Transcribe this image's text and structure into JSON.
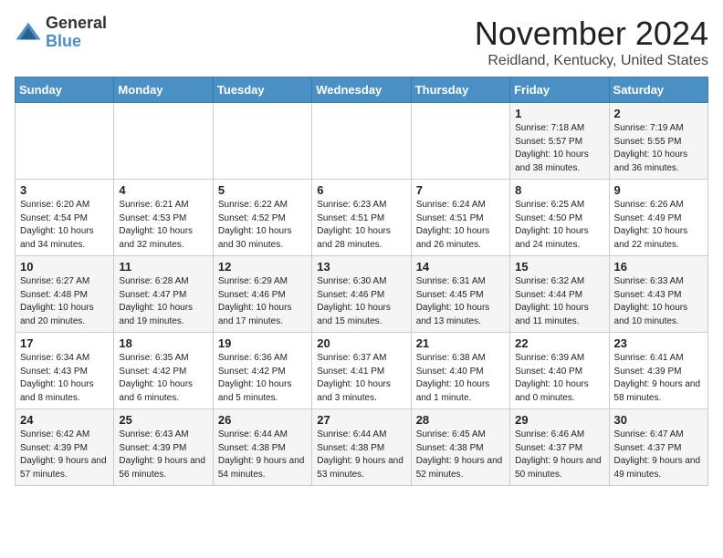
{
  "logo": {
    "general": "General",
    "blue": "Blue"
  },
  "title": "November 2024",
  "location": "Reidland, Kentucky, United States",
  "days_of_week": [
    "Sunday",
    "Monday",
    "Tuesday",
    "Wednesday",
    "Thursday",
    "Friday",
    "Saturday"
  ],
  "weeks": [
    [
      {
        "day": "",
        "info": ""
      },
      {
        "day": "",
        "info": ""
      },
      {
        "day": "",
        "info": ""
      },
      {
        "day": "",
        "info": ""
      },
      {
        "day": "",
        "info": ""
      },
      {
        "day": "1",
        "info": "Sunrise: 7:18 AM\nSunset: 5:57 PM\nDaylight: 10 hours and 38 minutes."
      },
      {
        "day": "2",
        "info": "Sunrise: 7:19 AM\nSunset: 5:55 PM\nDaylight: 10 hours and 36 minutes."
      }
    ],
    [
      {
        "day": "3",
        "info": "Sunrise: 6:20 AM\nSunset: 4:54 PM\nDaylight: 10 hours and 34 minutes."
      },
      {
        "day": "4",
        "info": "Sunrise: 6:21 AM\nSunset: 4:53 PM\nDaylight: 10 hours and 32 minutes."
      },
      {
        "day": "5",
        "info": "Sunrise: 6:22 AM\nSunset: 4:52 PM\nDaylight: 10 hours and 30 minutes."
      },
      {
        "day": "6",
        "info": "Sunrise: 6:23 AM\nSunset: 4:51 PM\nDaylight: 10 hours and 28 minutes."
      },
      {
        "day": "7",
        "info": "Sunrise: 6:24 AM\nSunset: 4:51 PM\nDaylight: 10 hours and 26 minutes."
      },
      {
        "day": "8",
        "info": "Sunrise: 6:25 AM\nSunset: 4:50 PM\nDaylight: 10 hours and 24 minutes."
      },
      {
        "day": "9",
        "info": "Sunrise: 6:26 AM\nSunset: 4:49 PM\nDaylight: 10 hours and 22 minutes."
      }
    ],
    [
      {
        "day": "10",
        "info": "Sunrise: 6:27 AM\nSunset: 4:48 PM\nDaylight: 10 hours and 20 minutes."
      },
      {
        "day": "11",
        "info": "Sunrise: 6:28 AM\nSunset: 4:47 PM\nDaylight: 10 hours and 19 minutes."
      },
      {
        "day": "12",
        "info": "Sunrise: 6:29 AM\nSunset: 4:46 PM\nDaylight: 10 hours and 17 minutes."
      },
      {
        "day": "13",
        "info": "Sunrise: 6:30 AM\nSunset: 4:46 PM\nDaylight: 10 hours and 15 minutes."
      },
      {
        "day": "14",
        "info": "Sunrise: 6:31 AM\nSunset: 4:45 PM\nDaylight: 10 hours and 13 minutes."
      },
      {
        "day": "15",
        "info": "Sunrise: 6:32 AM\nSunset: 4:44 PM\nDaylight: 10 hours and 11 minutes."
      },
      {
        "day": "16",
        "info": "Sunrise: 6:33 AM\nSunset: 4:43 PM\nDaylight: 10 hours and 10 minutes."
      }
    ],
    [
      {
        "day": "17",
        "info": "Sunrise: 6:34 AM\nSunset: 4:43 PM\nDaylight: 10 hours and 8 minutes."
      },
      {
        "day": "18",
        "info": "Sunrise: 6:35 AM\nSunset: 4:42 PM\nDaylight: 10 hours and 6 minutes."
      },
      {
        "day": "19",
        "info": "Sunrise: 6:36 AM\nSunset: 4:42 PM\nDaylight: 10 hours and 5 minutes."
      },
      {
        "day": "20",
        "info": "Sunrise: 6:37 AM\nSunset: 4:41 PM\nDaylight: 10 hours and 3 minutes."
      },
      {
        "day": "21",
        "info": "Sunrise: 6:38 AM\nSunset: 4:40 PM\nDaylight: 10 hours and 1 minute."
      },
      {
        "day": "22",
        "info": "Sunrise: 6:39 AM\nSunset: 4:40 PM\nDaylight: 10 hours and 0 minutes."
      },
      {
        "day": "23",
        "info": "Sunrise: 6:41 AM\nSunset: 4:39 PM\nDaylight: 9 hours and 58 minutes."
      }
    ],
    [
      {
        "day": "24",
        "info": "Sunrise: 6:42 AM\nSunset: 4:39 PM\nDaylight: 9 hours and 57 minutes."
      },
      {
        "day": "25",
        "info": "Sunrise: 6:43 AM\nSunset: 4:39 PM\nDaylight: 9 hours and 56 minutes."
      },
      {
        "day": "26",
        "info": "Sunrise: 6:44 AM\nSunset: 4:38 PM\nDaylight: 9 hours and 54 minutes."
      },
      {
        "day": "27",
        "info": "Sunrise: 6:44 AM\nSunset: 4:38 PM\nDaylight: 9 hours and 53 minutes."
      },
      {
        "day": "28",
        "info": "Sunrise: 6:45 AM\nSunset: 4:38 PM\nDaylight: 9 hours and 52 minutes."
      },
      {
        "day": "29",
        "info": "Sunrise: 6:46 AM\nSunset: 4:37 PM\nDaylight: 9 hours and 50 minutes."
      },
      {
        "day": "30",
        "info": "Sunrise: 6:47 AM\nSunset: 4:37 PM\nDaylight: 9 hours and 49 minutes."
      }
    ]
  ]
}
